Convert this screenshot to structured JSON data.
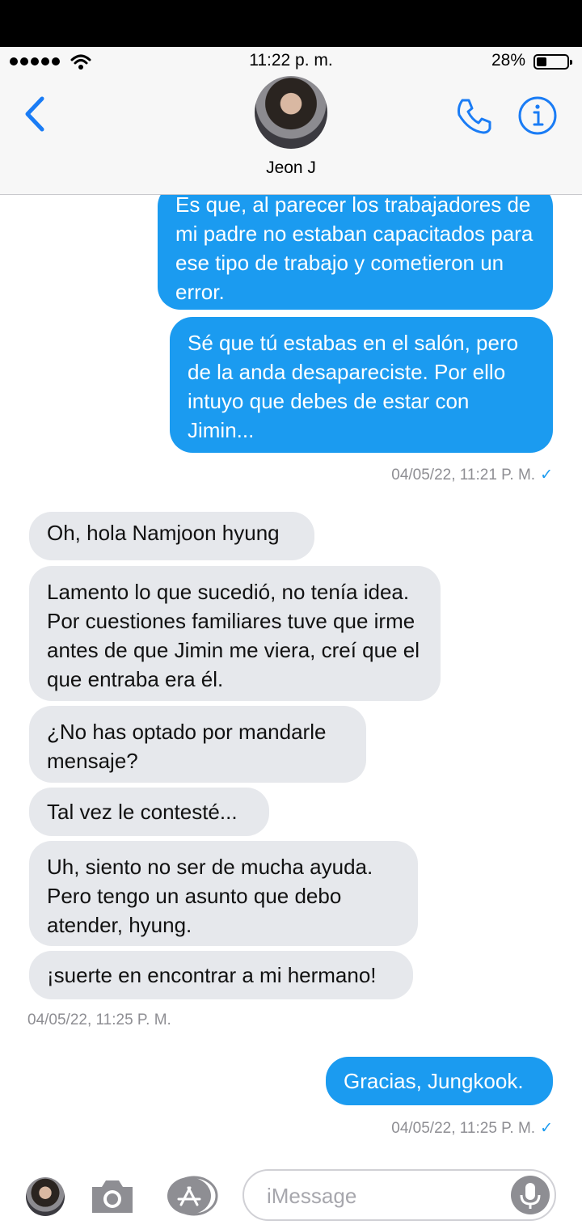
{
  "status_bar": {
    "time": "11:22 p. m.",
    "battery_percent": "28%",
    "battery_level": 0.28,
    "signal_bars": 5
  },
  "header": {
    "back_icon": "chevron-left-icon",
    "contact_name": "Jeon J",
    "call_icon": "phone-icon",
    "info_icon": "info-icon"
  },
  "messages": [
    {
      "type": "sent",
      "text": "Es que, al parecer los trabajadores de mi padre no estaban capacitados para ese tipo de trabajo y cometieron un error."
    },
    {
      "type": "sent",
      "text": "Sé que tú estabas en el salón, pero de la anda desapareciste. Por ello intuyo que debes de estar con Jimin..."
    },
    {
      "type": "stamp",
      "text": "04/05/22, 11:21 P. M.",
      "check": "✓"
    },
    {
      "type": "received",
      "text": "Oh, hola Namjoon hyung"
    },
    {
      "type": "received",
      "text": "Lamento lo que sucedió, no tenía idea. Por cuestiones familiares tuve que irme antes de que Jimin me viera, creí que el que entraba era él."
    },
    {
      "type": "received",
      "text": "¿No has optado por mandarle mensaje?"
    },
    {
      "type": "received",
      "text": "Tal vez le contesté..."
    },
    {
      "type": "received",
      "text": "Uh, siento no ser de mucha ayuda. Pero tengo un asunto que debo atender, hyung."
    },
    {
      "type": "received",
      "text": "¡suerte en encontrar a mi hermano!"
    },
    {
      "type": "stamp",
      "text": "04/05/22, 11:25 P. M."
    },
    {
      "type": "sent",
      "text": "Gracias, Jungkook."
    },
    {
      "type": "stamp",
      "text": "04/05/22, 11:25 P. M.",
      "check": "✓"
    }
  ],
  "composer": {
    "placeholder": "iMessage",
    "camera_icon": "camera-icon",
    "apps_icon": "app-store-icon",
    "mic_icon": "microphone-icon"
  },
  "colors": {
    "sent_bubble": "#1b9bf0",
    "received_bubble": "#e6e8ec",
    "accent": "#1a7cf5",
    "timestamp": "#8e8e93"
  }
}
